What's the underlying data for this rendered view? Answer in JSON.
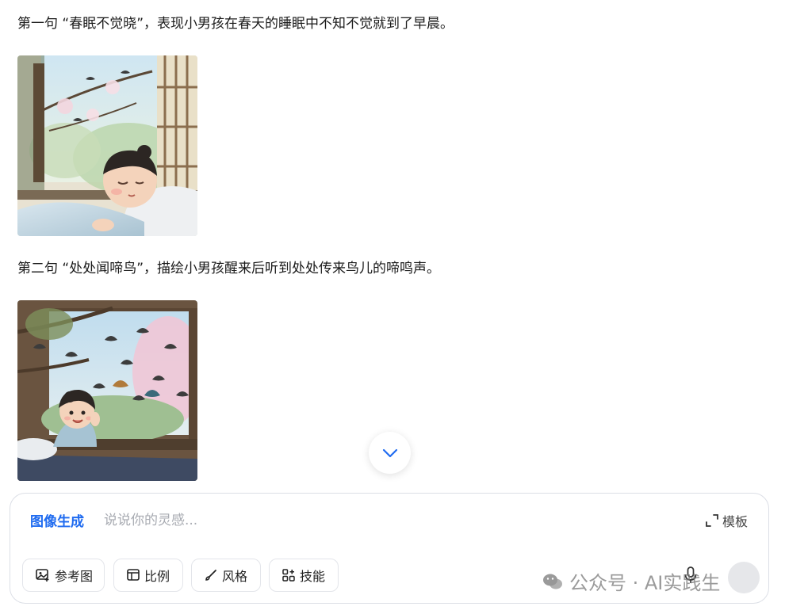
{
  "chat": {
    "line1": "第一句 “春眠不觉晓”，表现小男孩在春天的睡眠中不知不觉就到了早晨。",
    "line2": "第二句 “处处闻啼鸟”，描绘小男孩醒来后听到处处传来鸟儿的啼鸣声。"
  },
  "composer": {
    "mode_label": "图像生成",
    "placeholder": "说说你的灵感...",
    "template_label": "模板",
    "tools": {
      "reference": "参考图",
      "ratio": "比例",
      "style": "风格",
      "skill": "技能"
    }
  },
  "watermark": {
    "text": "公众号 · AI实践生"
  },
  "colors": {
    "accent": "#1f6bf0",
    "border": "#dcdfe6",
    "placeholder": "#a8abb2"
  }
}
